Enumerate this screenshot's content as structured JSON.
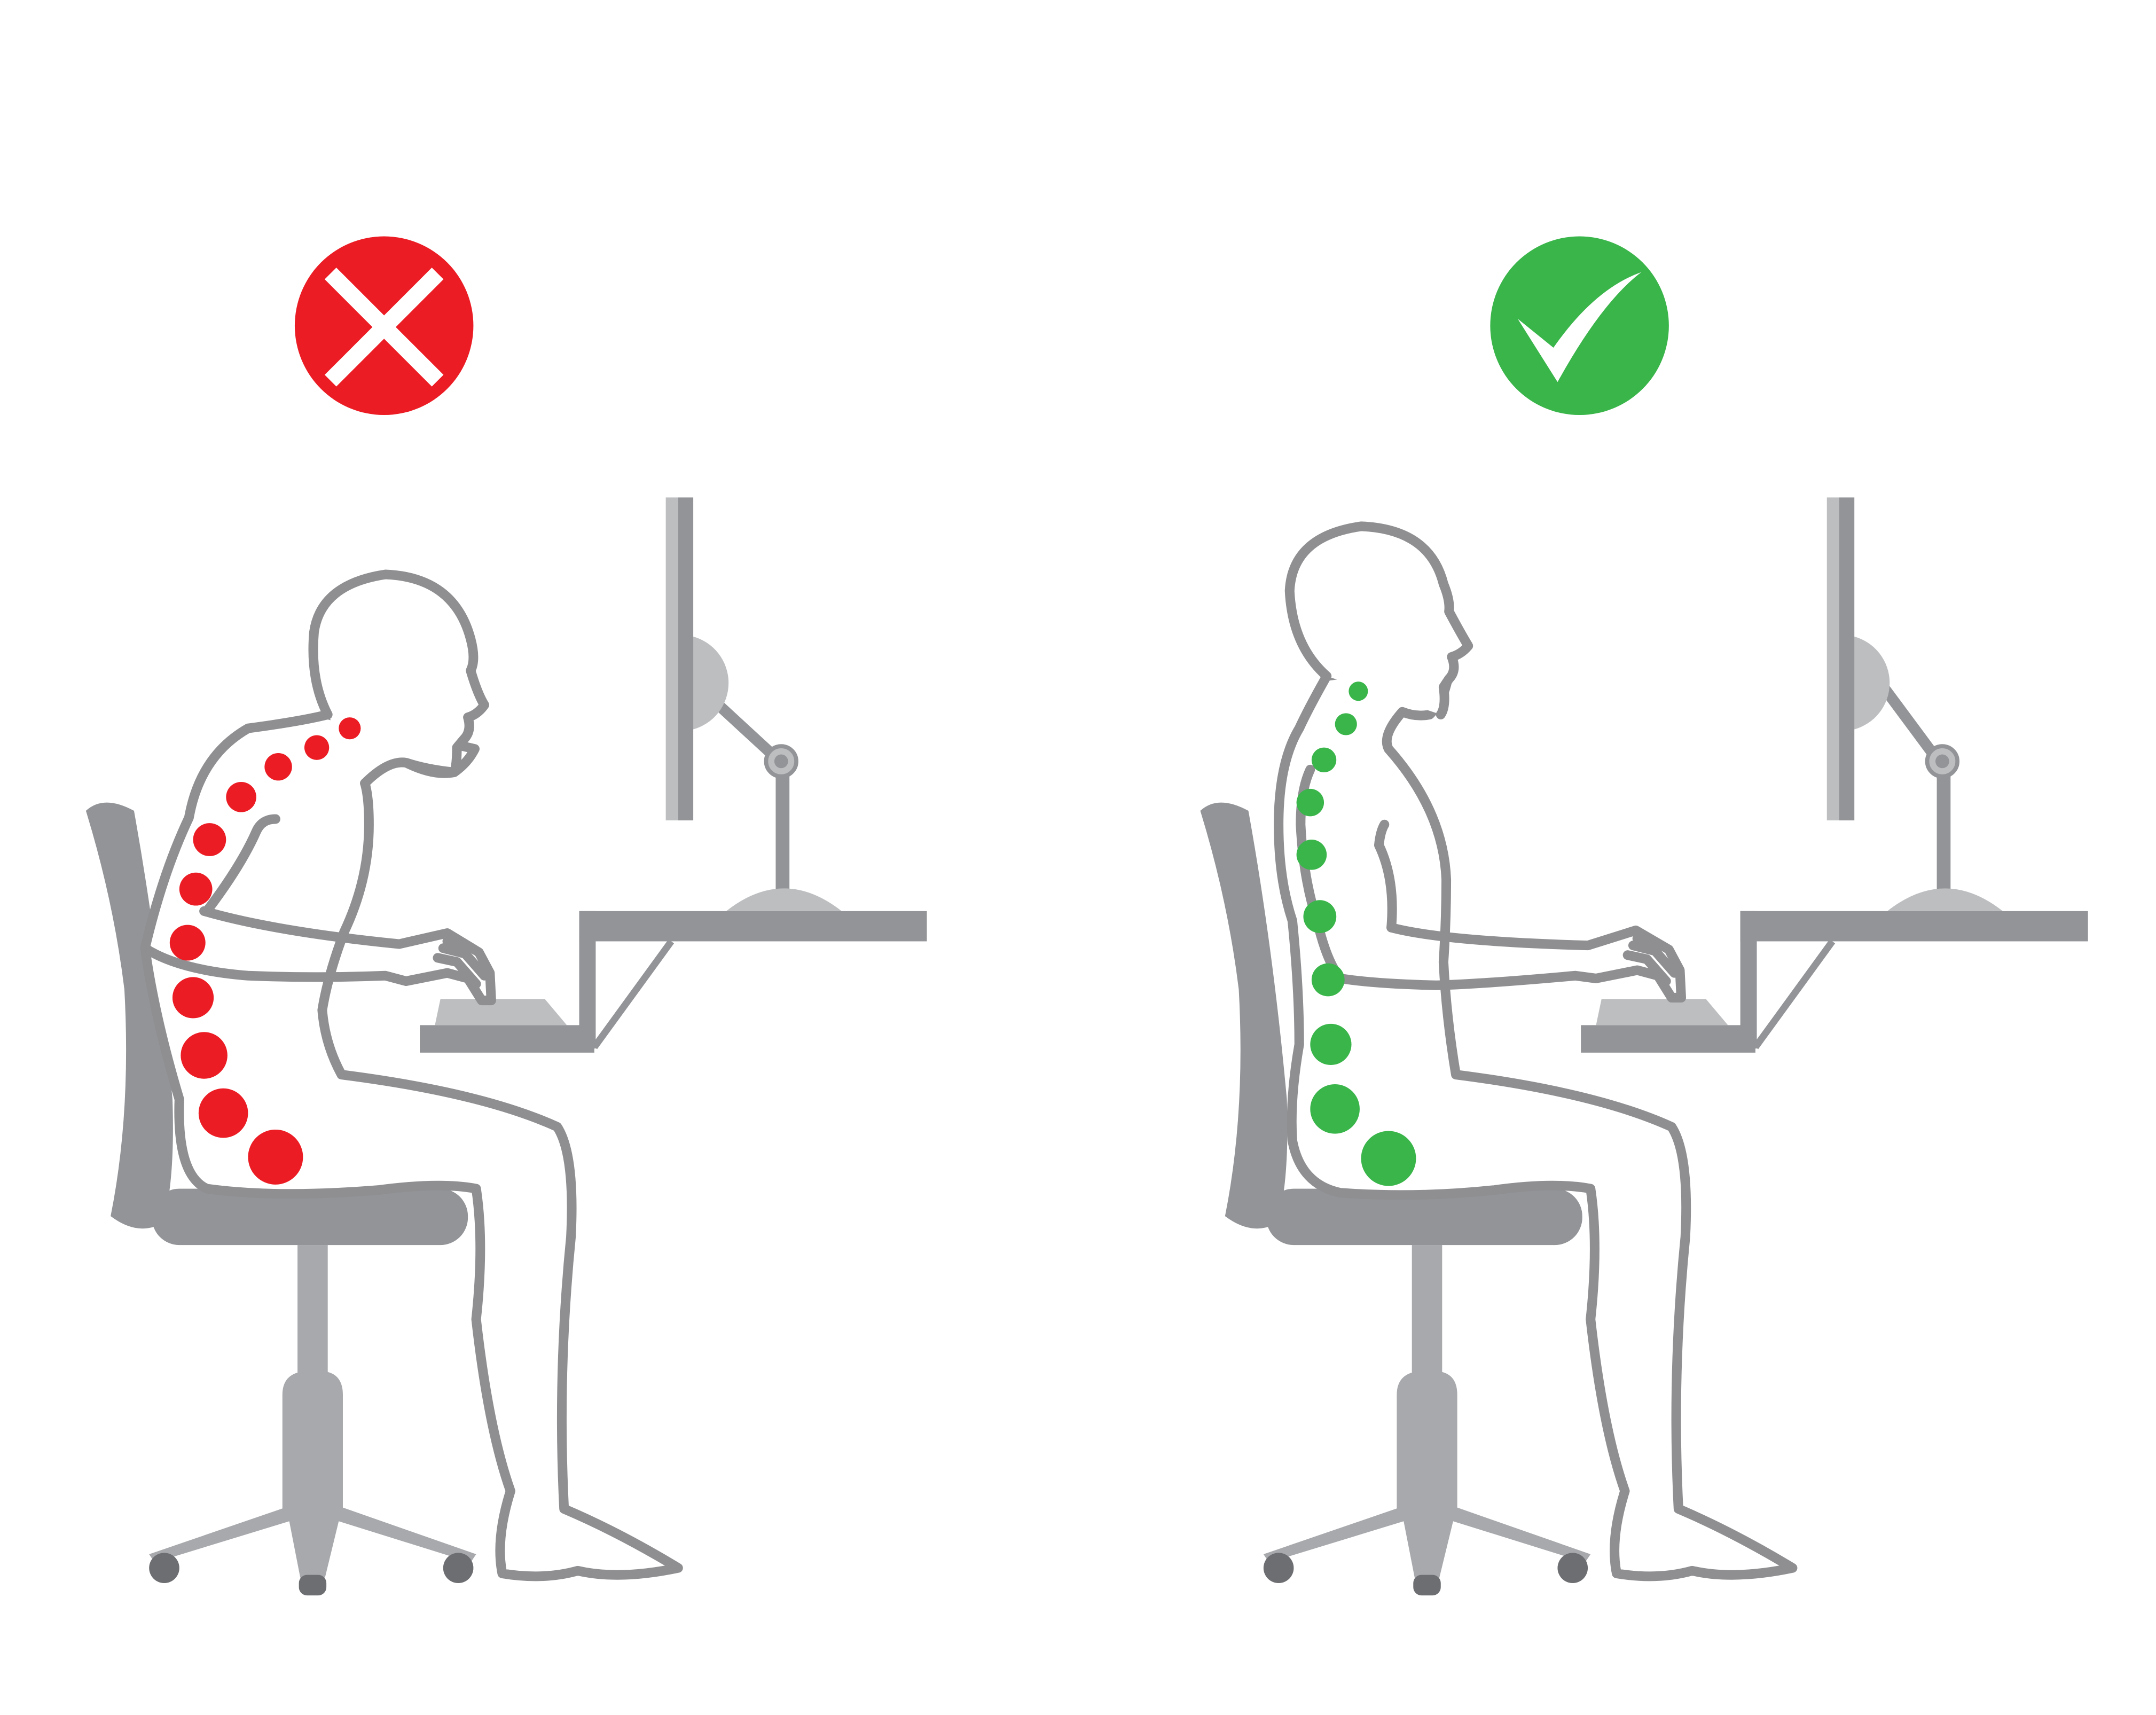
{
  "colors": {
    "background": "#ffffff",
    "bad": "#ec1c24",
    "good": "#39b54a",
    "furniture": "#929497",
    "furniture_light": "#a7a9ac",
    "wheel": "#6d6e71",
    "outline": "#8f8f92"
  },
  "panels": [
    {
      "id": "incorrect",
      "badge_icon": "cross-icon",
      "badge_color": "#ec1c24",
      "posture": "slouched",
      "spine_dot_color": "#ec1c24"
    },
    {
      "id": "correct",
      "badge_icon": "checkmark-icon",
      "badge_color": "#39b54a",
      "posture": "upright",
      "spine_dot_color": "#39b54a"
    }
  ]
}
